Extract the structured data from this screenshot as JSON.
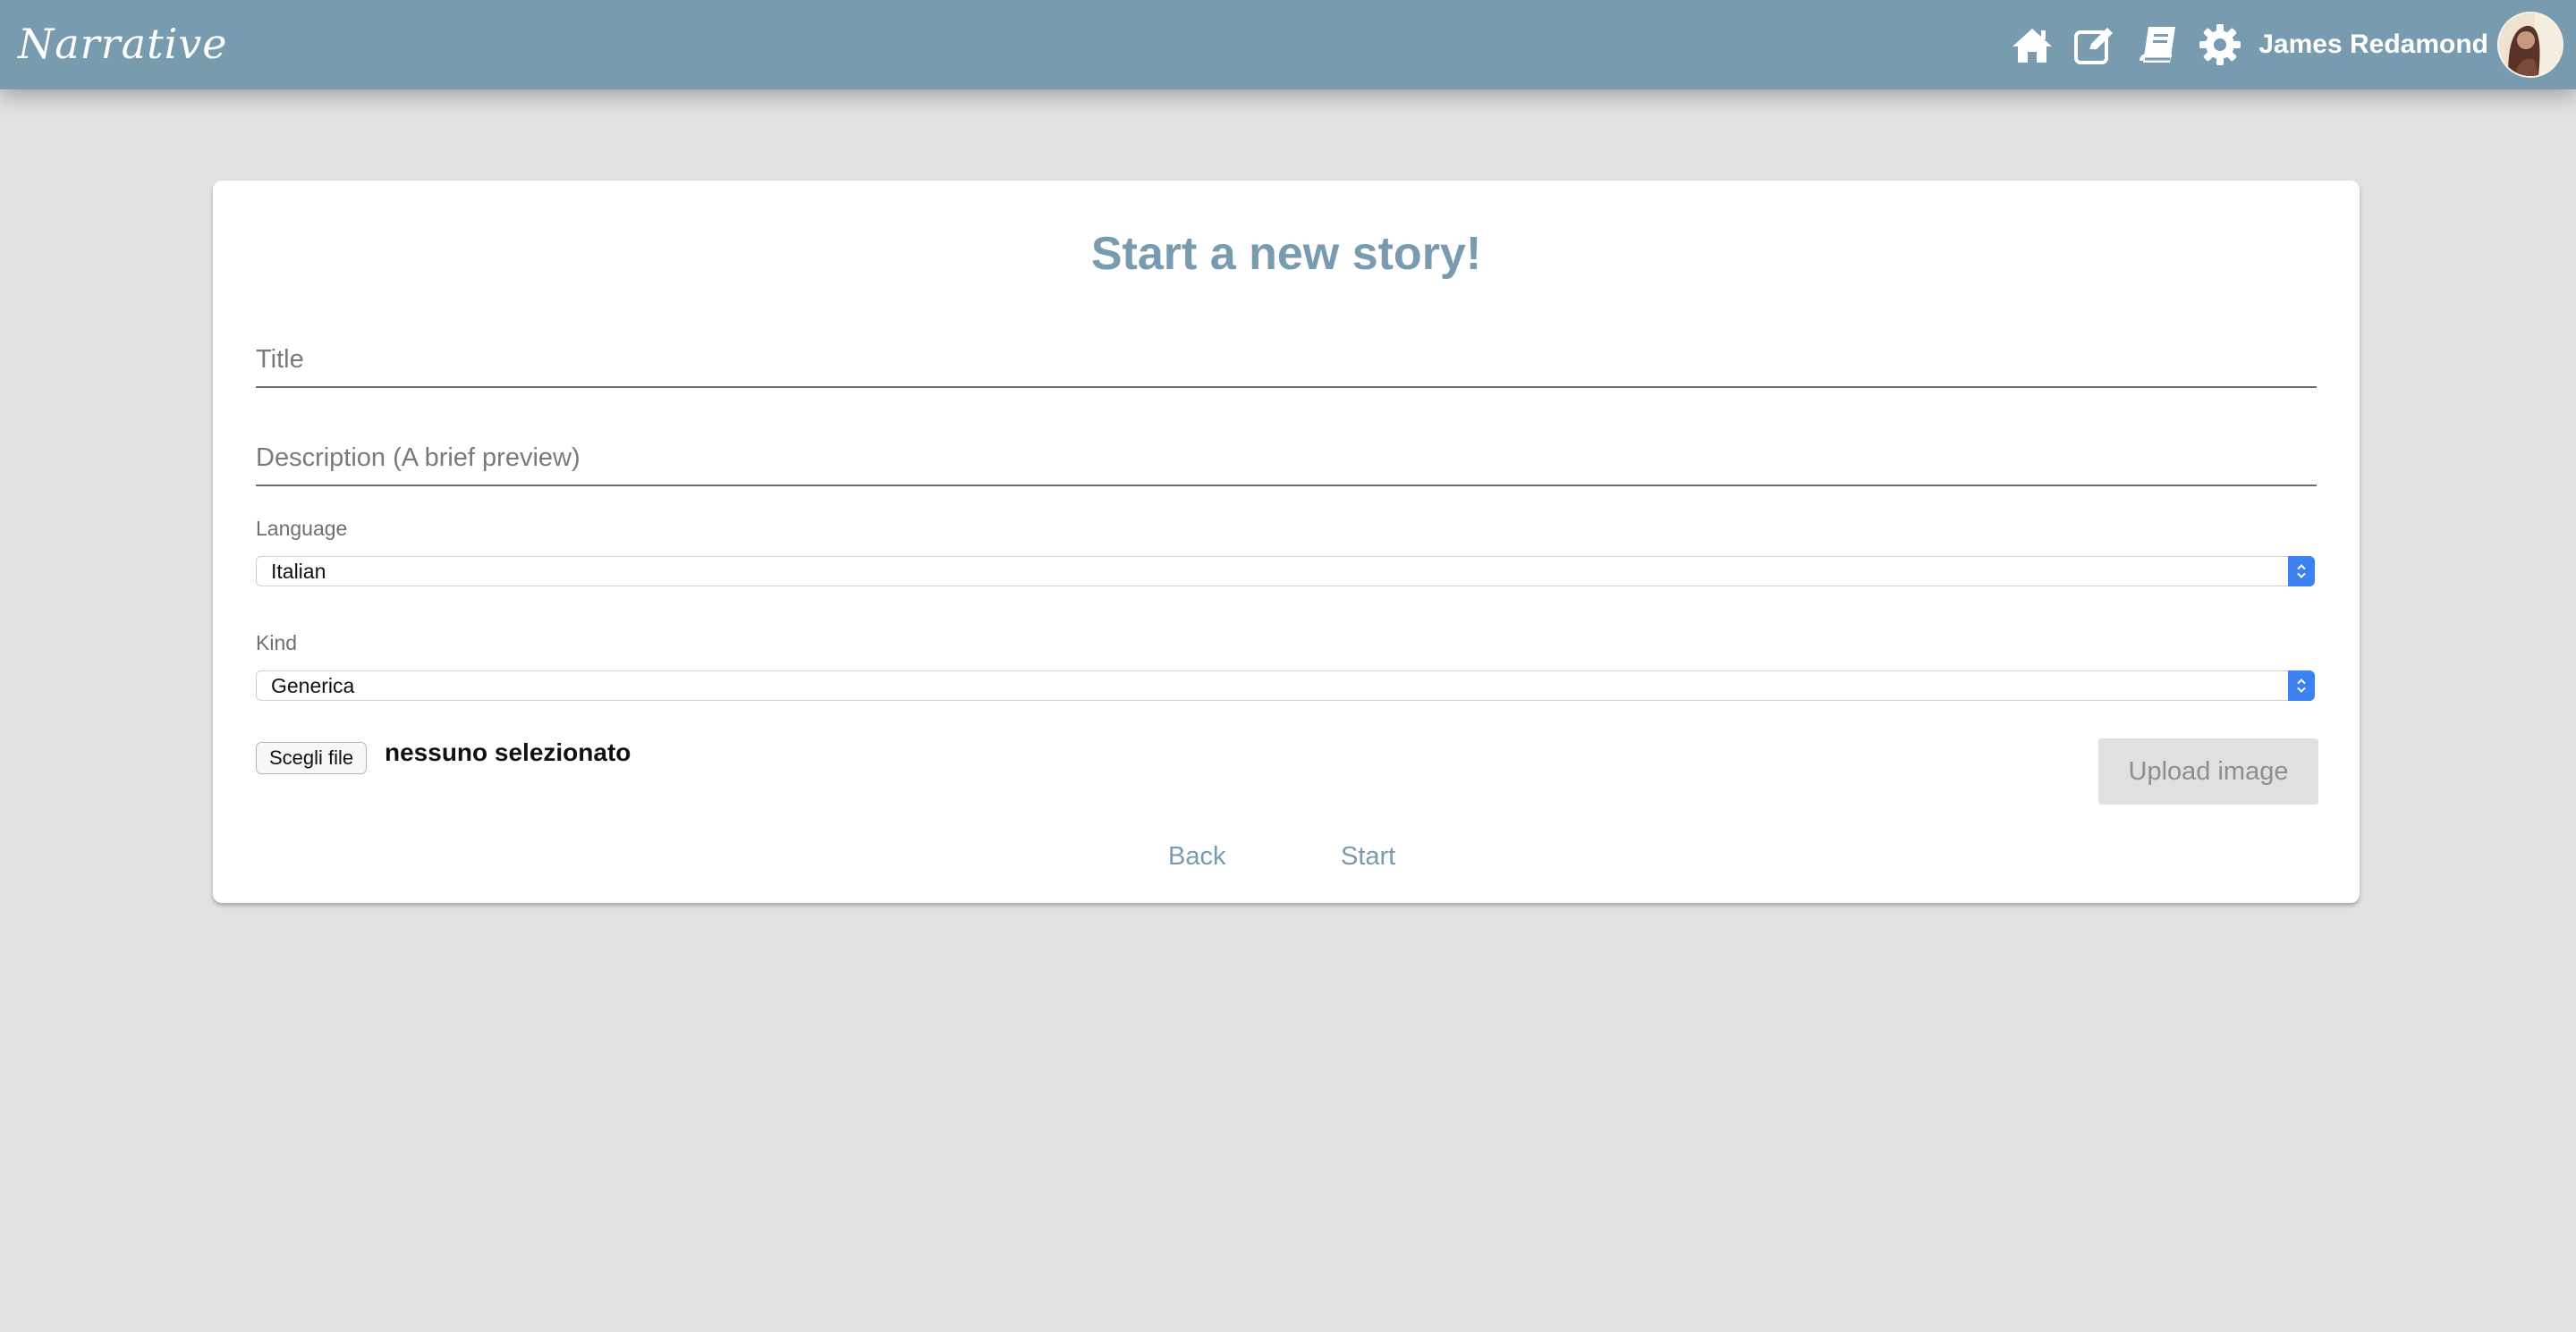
{
  "app": {
    "logo_text": "Narrative",
    "user_name": "James Redamond"
  },
  "nav": {
    "icons": [
      "home-icon",
      "edit-icon",
      "book-icon",
      "gear-icon"
    ]
  },
  "form": {
    "title": "Start a new story!",
    "title_field": {
      "placeholder": "Title",
      "value": ""
    },
    "description_field": {
      "placeholder": "Description (A brief preview)",
      "value": ""
    },
    "language": {
      "label": "Language",
      "selected": "Italian"
    },
    "kind": {
      "label": "Kind",
      "selected": "Generica"
    },
    "file": {
      "button_label": "Scegli file",
      "status": "nessuno selezionato"
    },
    "upload_button": "Upload image",
    "back_label": "Back",
    "start_label": "Start"
  },
  "colors": {
    "brand": "#789bb0",
    "select_accent": "#3b82f0",
    "background": "#e2e2e2"
  }
}
